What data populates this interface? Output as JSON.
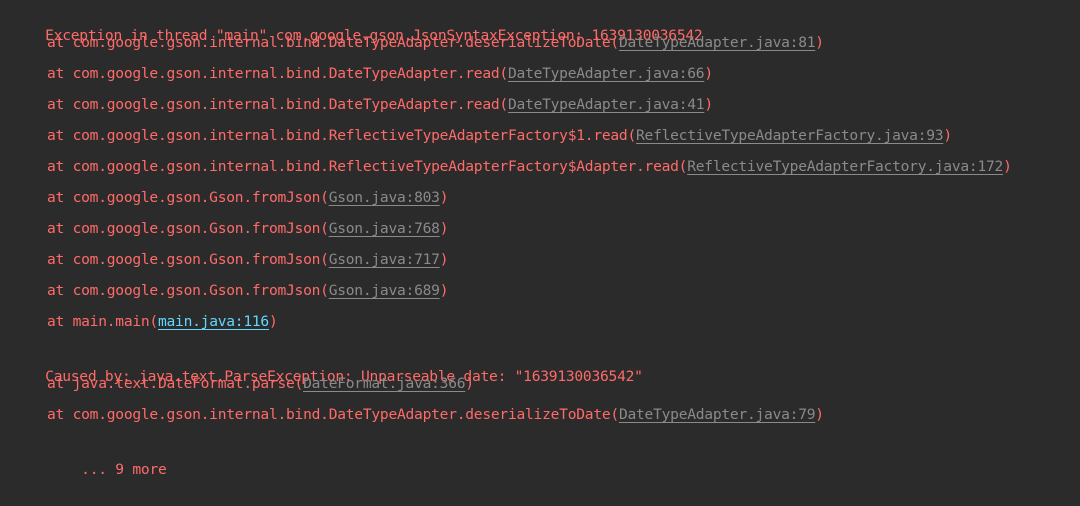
{
  "console": {
    "lines": [
      {
        "text": "Exception in thread \"main\" com.google.gson.JsonSyntaxException: 1639130036542",
        "prefix": "",
        "link": "",
        "suffix": ""
      },
      {
        "prefix": "at com.google.gson.internal.bind.DateTypeAdapter.deserializeToDate(",
        "link": "DateTypeAdapter.java:81",
        "suffix": ")"
      },
      {
        "prefix": "at com.google.gson.internal.bind.DateTypeAdapter.read(",
        "link": "DateTypeAdapter.java:66",
        "suffix": ")"
      },
      {
        "prefix": "at com.google.gson.internal.bind.DateTypeAdapter.read(",
        "link": "DateTypeAdapter.java:41",
        "suffix": ")"
      },
      {
        "prefix": "at com.google.gson.internal.bind.ReflectiveTypeAdapterFactory$1.read(",
        "link": "ReflectiveTypeAdapterFactory.java:93",
        "suffix": ")"
      },
      {
        "prefix": "at com.google.gson.internal.bind.ReflectiveTypeAdapterFactory$Adapter.read(",
        "link": "ReflectiveTypeAdapterFactory.java:172",
        "suffix": ")"
      },
      {
        "prefix": "at com.google.gson.Gson.fromJson(",
        "link": "Gson.java:803",
        "suffix": ")"
      },
      {
        "prefix": "at com.google.gson.Gson.fromJson(",
        "link": "Gson.java:768",
        "suffix": ")"
      },
      {
        "prefix": "at com.google.gson.Gson.fromJson(",
        "link": "Gson.java:717",
        "suffix": ")"
      },
      {
        "prefix": "at com.google.gson.Gson.fromJson(",
        "link": "Gson.java:689",
        "suffix": ")"
      },
      {
        "prefix": "at main.main(",
        "link": "main.java:116",
        "suffix": ")"
      },
      {
        "text": "Caused by: java.text.ParseException: Unparseable date: \"1639130036542\""
      },
      {
        "prefix": "at java.text.DateFormat.parse(",
        "link": "DateFormat.java:366",
        "suffix": ")"
      },
      {
        "prefix": "at com.google.gson.internal.bind.DateTypeAdapter.deserializeToDate(",
        "link": "DateTypeAdapter.java:79",
        "suffix": ")"
      },
      {
        "text": "... 9 more"
      }
    ]
  },
  "colors": {
    "background": "#2b2b2b",
    "error_text": "#ff6b68",
    "library_link": "#8a8a8a",
    "user_code_link": "#62d6ff"
  }
}
